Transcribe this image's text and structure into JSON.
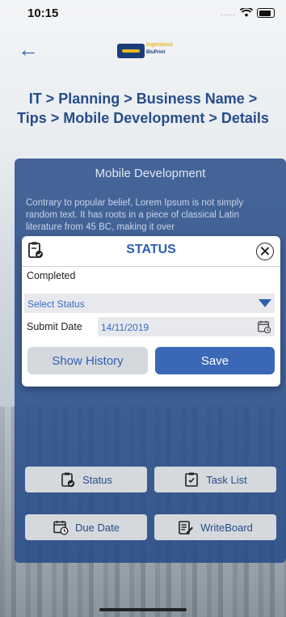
{
  "status_bar": {
    "time": "10:15"
  },
  "header": {
    "logo_top": "Ingenious",
    "logo_bottom": "BluPrint"
  },
  "breadcrumb": "IT > Planning > Business Name > Tips > Mobile Development > Details",
  "panel": {
    "title": "Mobile Development",
    "text": "Contrary to popular belief, Lorem Ipsum is not simply random text. It has roots in a piece of classical Latin literature from 45 BC, making it over",
    "buttons": {
      "status": "Status",
      "task_list": "Task List",
      "due_date": "Due Date",
      "writeboard": "WriteBoard"
    }
  },
  "modal": {
    "title": "STATUS",
    "current_status": "Completed",
    "select_placeholder": "Select Status",
    "submit_date_label": "Submit Date",
    "submit_date_value": "14/11/2019",
    "show_history_label": "Show History",
    "save_label": "Save"
  },
  "colors": {
    "accent": "#2f5fb0",
    "panel": "#214785",
    "save": "#3a68b7"
  }
}
